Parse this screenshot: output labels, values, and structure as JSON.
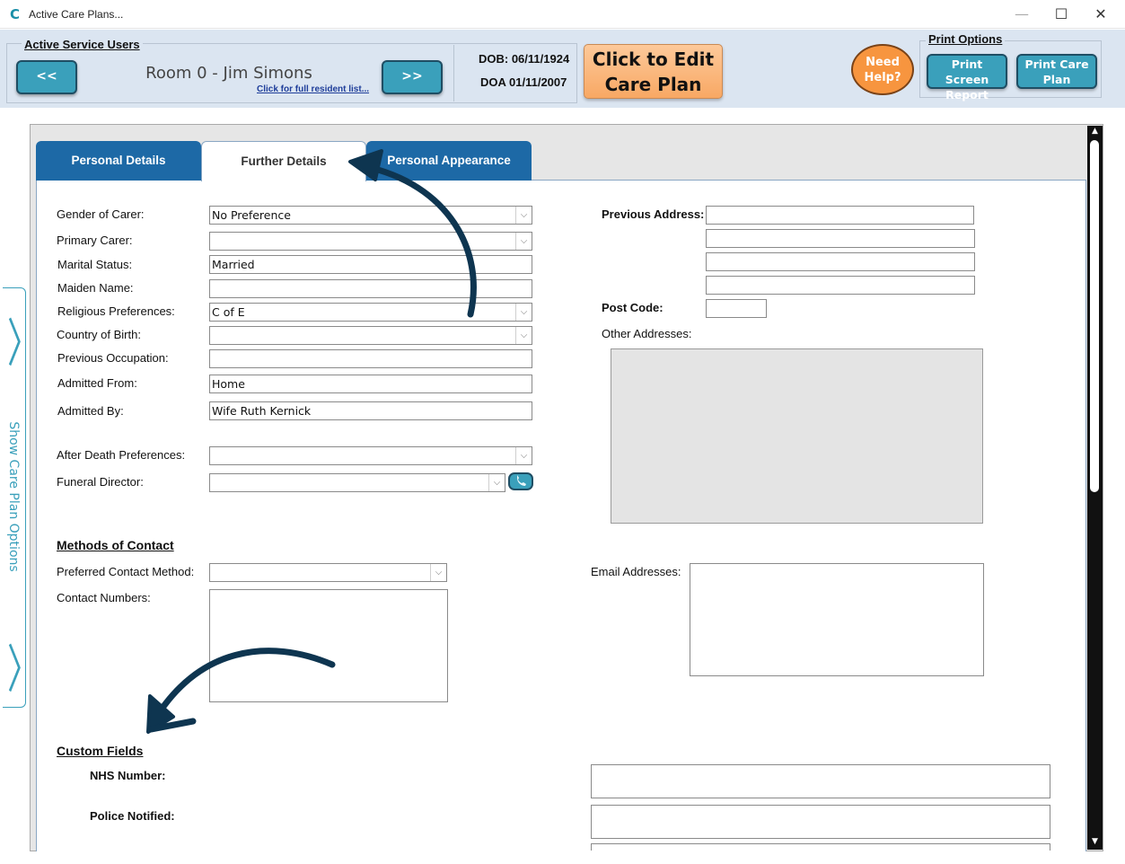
{
  "window": {
    "title": "Active Care Plans...",
    "app_icon_glyph": "C",
    "minimize": "—",
    "maximize": "☐",
    "close": "✕"
  },
  "header": {
    "service_users_legend": "Active Service Users",
    "prev_label": "<<",
    "next_label": ">>",
    "resident_name": "Room 0 - Jim Simons",
    "resident_link": "Click for full resident list...",
    "dob": "DOB: 06/11/1924",
    "doa": "DOA 01/11/2007",
    "edit_line1": "Click to Edit",
    "edit_line2": "Care Plan",
    "help_line1": "Need",
    "help_line2": "Help?",
    "print_legend": "Print Options",
    "print_screen_line1": "Print Screen",
    "print_screen_line2": "Report",
    "print_care_line1": "Print Care",
    "print_care_line2": "Plan"
  },
  "tabs": [
    {
      "label": "Personal Details",
      "active": false
    },
    {
      "label": "Further Details",
      "active": true
    },
    {
      "label": "Personal Appearance",
      "active": false
    }
  ],
  "fields": {
    "gender_of_carer": {
      "label": "Gender of Carer:",
      "value": "No Preference"
    },
    "primary_carer": {
      "label": "Primary Carer:",
      "value": ""
    },
    "marital_status": {
      "label": "Marital Status:",
      "value": "Married"
    },
    "maiden_name": {
      "label": "Maiden Name:",
      "value": ""
    },
    "religious_preferences": {
      "label": "Religious Preferences:",
      "value": "C of E"
    },
    "country_of_birth": {
      "label": "Country of Birth:",
      "value": ""
    },
    "previous_occupation": {
      "label": "Previous Occupation:",
      "value": ""
    },
    "admitted_from": {
      "label": "Admitted From:",
      "value": "Home"
    },
    "admitted_by": {
      "label": "Admitted By:",
      "value": "Wife Ruth Kernick"
    },
    "after_death_preferences": {
      "label": "After Death Preferences:",
      "value": ""
    },
    "funeral_director": {
      "label": "Funeral Director:",
      "value": ""
    },
    "previous_address": {
      "label": "Previous Address:",
      "lines": [
        "",
        "",
        "",
        ""
      ]
    },
    "post_code": {
      "label": "Post Code:",
      "value": ""
    },
    "other_addresses": {
      "label": "Other Addresses:"
    }
  },
  "methods_of_contact": {
    "title": "Methods of Contact",
    "preferred_contact_method": {
      "label": "Preferred Contact Method:",
      "value": ""
    },
    "contact_numbers": {
      "label": "Contact Numbers:"
    },
    "email_addresses": {
      "label": "Email Addresses:"
    }
  },
  "custom_fields": {
    "title": "Custom Fields",
    "nhs_number": {
      "label": "NHS Number:",
      "value": ""
    },
    "police_notified": {
      "label": "Police Notified:",
      "value": ""
    }
  },
  "side_panel": {
    "label": "Show Care Plan Options"
  },
  "colors": {
    "accent": "#3aa0bb",
    "tab_blue": "#1d69a6",
    "header_bg": "#dbe5f1",
    "edit_orange": "#f8a864",
    "help_orange": "#f7953f",
    "arrow": "#0e3550"
  }
}
